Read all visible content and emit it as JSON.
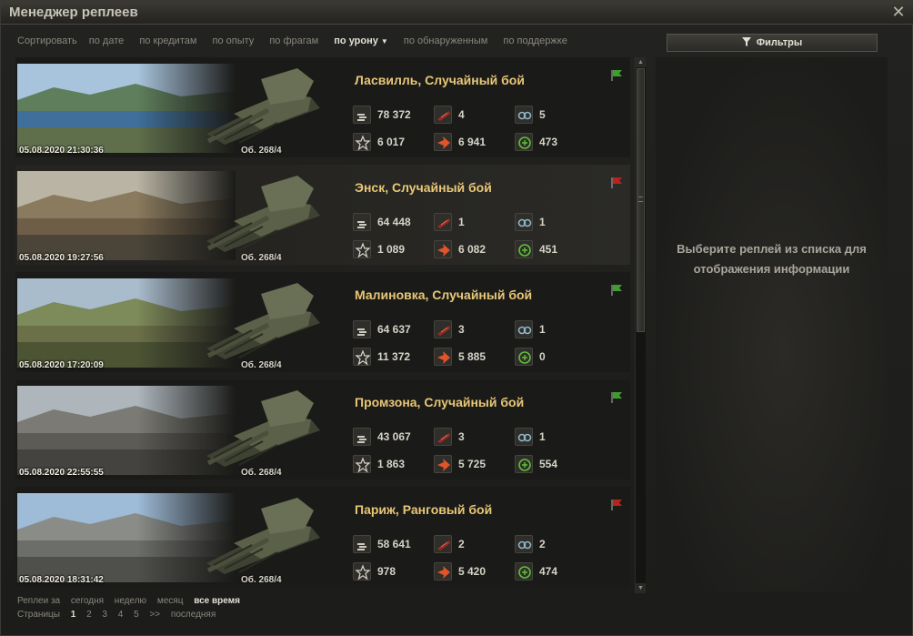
{
  "window": {
    "title": "Менеджер реплеев",
    "close": "✕"
  },
  "sort": {
    "label": "Сортировать",
    "options": [
      "по дате",
      "по кредитам",
      "по опыту",
      "по фрагам",
      "по урону",
      "по обнаруженным",
      "по поддержке"
    ],
    "active": "по урону"
  },
  "filters": {
    "label": "Фильтры"
  },
  "info": {
    "line1": "Выберите реплей из списка для",
    "line2": "отображения информации"
  },
  "replays": [
    {
      "title": "Ласвилль, Случайный бой",
      "date": "05.08.2020 21:30:36",
      "tank": "Об. 268/4",
      "result": "win",
      "credits": "78 372",
      "kills": "4",
      "spotted": "5",
      "xp": "6 017",
      "damage": "6 941",
      "assist": "473",
      "map": "lake"
    },
    {
      "title": "Энск, Случайный бой",
      "date": "05.08.2020 19:27:56",
      "tank": "Об. 268/4",
      "result": "loss",
      "credits": "64 448",
      "kills": "1",
      "spotted": "1",
      "xp": "1 089",
      "damage": "6 082",
      "assist": "451",
      "map": "city"
    },
    {
      "title": "Малиновка, Случайный бой",
      "date": "05.08.2020 17:20:09",
      "tank": "Об. 268/4",
      "result": "win",
      "credits": "64 637",
      "kills": "3",
      "spotted": "1",
      "xp": "11 372",
      "damage": "5 885",
      "assist": "0",
      "map": "field"
    },
    {
      "title": "Промзона, Случайный бой",
      "date": "05.08.2020 22:55:55",
      "tank": "Об. 268/4",
      "result": "win",
      "credits": "43 067",
      "kills": "3",
      "spotted": "1",
      "xp": "1 863",
      "damage": "5 725",
      "assist": "554",
      "map": "industry"
    },
    {
      "title": "Париж, Ранговый бой",
      "date": "05.08.2020 18:31:42",
      "tank": "Об. 268/4",
      "result": "loss",
      "credits": "58 641",
      "kills": "2",
      "spotted": "2",
      "xp": "978",
      "damage": "5 420",
      "assist": "474",
      "map": "paris"
    }
  ],
  "period": {
    "label": "Реплеи за",
    "options": [
      "сегодня",
      "неделю",
      "месяц",
      "все время"
    ],
    "active": "все время"
  },
  "pages": {
    "label": "Страницы",
    "items": [
      "1",
      "2",
      "3",
      "4",
      "5",
      ">>",
      "последняя"
    ],
    "active": "1"
  },
  "colors": {
    "title": "#e8c777",
    "win": "#3d9e2e",
    "loss": "#b8231c"
  },
  "icons": {
    "credits": "coins-icon",
    "kills": "frag-icon",
    "spotted": "binoculars-icon",
    "xp": "star-icon",
    "damage": "damage-icon",
    "assist": "assist-icon",
    "close": "close-icon",
    "filter": "funnel-icon"
  }
}
